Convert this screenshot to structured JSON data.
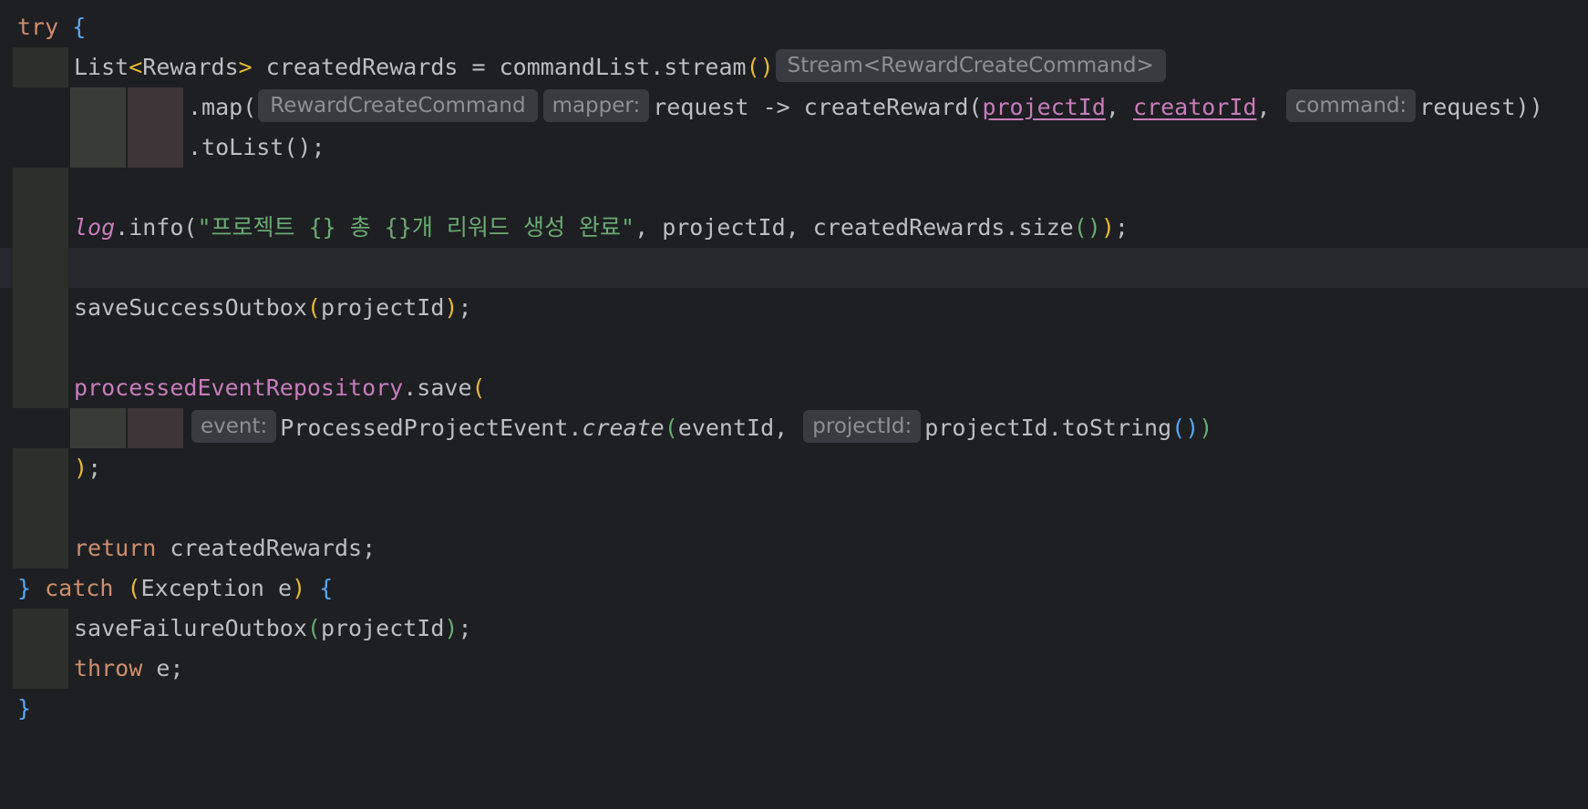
{
  "editor": {
    "lines": [
      {
        "t1": "try",
        "t2": "{"
      },
      {
        "type": "List",
        "generic": "Rewards",
        "var": " createdRewards = commandList.stream",
        "parens": "()",
        "hint": "Stream<RewardCreateCommand>"
      },
      {
        "method": ".map(",
        "hint_type": "RewardCreateCommand",
        "hint_param": "mapper:",
        "lambda": "request -> createReward(",
        "arg1": "projectId",
        "sep1": ", ",
        "arg2": "creatorId",
        "sep2": ",",
        "hint_cmd": "command:",
        "arg3": "request))"
      },
      {
        "text": ".toList();"
      },
      {
        "field": "log",
        "call": ".info(",
        "string": "\"프로젝트 {} 총 {}개 리워드 생성 완료\"",
        "rest": ", projectId, createdRewards.size",
        "close1": "()",
        "close2": ")",
        "end": ";"
      },
      {
        "text": ""
      },
      {
        "call": "saveSuccessOutbox",
        "open": "(",
        "arg": "projectId",
        "close": ")",
        "end": ";"
      },
      {
        "field": "processedEventRepository",
        "call": ".save",
        "open": "("
      },
      {
        "hint_event": "event:",
        "cls": "ProcessedProjectEvent.",
        "method": "create",
        "open": "(",
        "arg1": "eventId,",
        "hint_pid": "projectId:",
        "arg2": "projectId.toString",
        "parens": "()",
        "close": ")"
      },
      {
        "close": ")",
        "end": ";"
      },
      {
        "kw": "return",
        "rest": " createdRewards;"
      },
      {
        "brace": "}",
        "kw": "catch",
        "open": "(",
        "mid": "Exception e",
        "close": ")",
        "brace2": "{"
      },
      {
        "call": "saveFailureOutbox",
        "open": "(",
        "arg": "projectId",
        "close": ")",
        "end": ";"
      },
      {
        "kw": "throw",
        "rest": " e;"
      },
      {
        "brace": "}"
      }
    ]
  }
}
